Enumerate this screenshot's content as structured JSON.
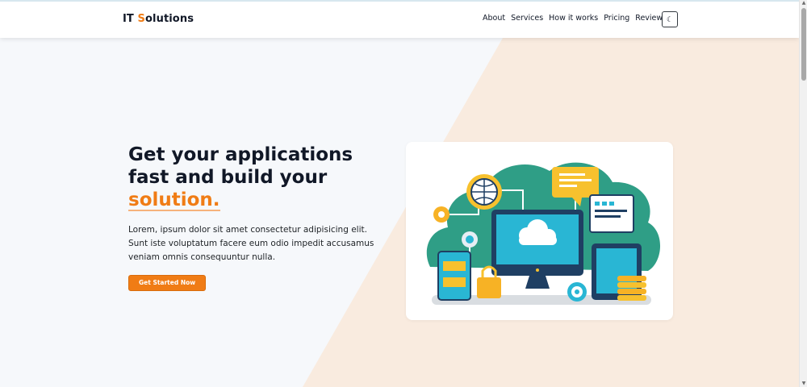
{
  "brand": {
    "prefix": "IT ",
    "accent": "S",
    "rest": "olutions"
  },
  "nav": {
    "items": [
      "About",
      "Services",
      "How it works",
      "Pricing",
      "Reviews"
    ]
  },
  "theme_toggle": {
    "icon": "moon-icon",
    "glyph": "☾"
  },
  "hero": {
    "headline_line1": "Get your applications",
    "headline_line2": "fast and build your",
    "headline_accent": "solution.",
    "lead": "Lorem, ipsum dolor sit amet consectetur adipisicing elit. Sunt iste voluptatum facere eum odio impedit accusamus veniam omnis consequuntur nulla.",
    "cta_label": "Get Started Now"
  },
  "illustration": {
    "icons": [
      "globe-icon",
      "chat-bubble-icon",
      "gear-icon",
      "cloud-icon",
      "monitor-icon",
      "tablet-icon",
      "padlock-icon",
      "folder-cabinet-icon",
      "coin-stack-icon",
      "target-icon",
      "document-icon"
    ]
  },
  "colors": {
    "accent": "#f07c15",
    "teal": "#2f9e86",
    "sky": "#29b6d4",
    "navy": "#1f3f63",
    "yellow": "#f7c12e"
  }
}
